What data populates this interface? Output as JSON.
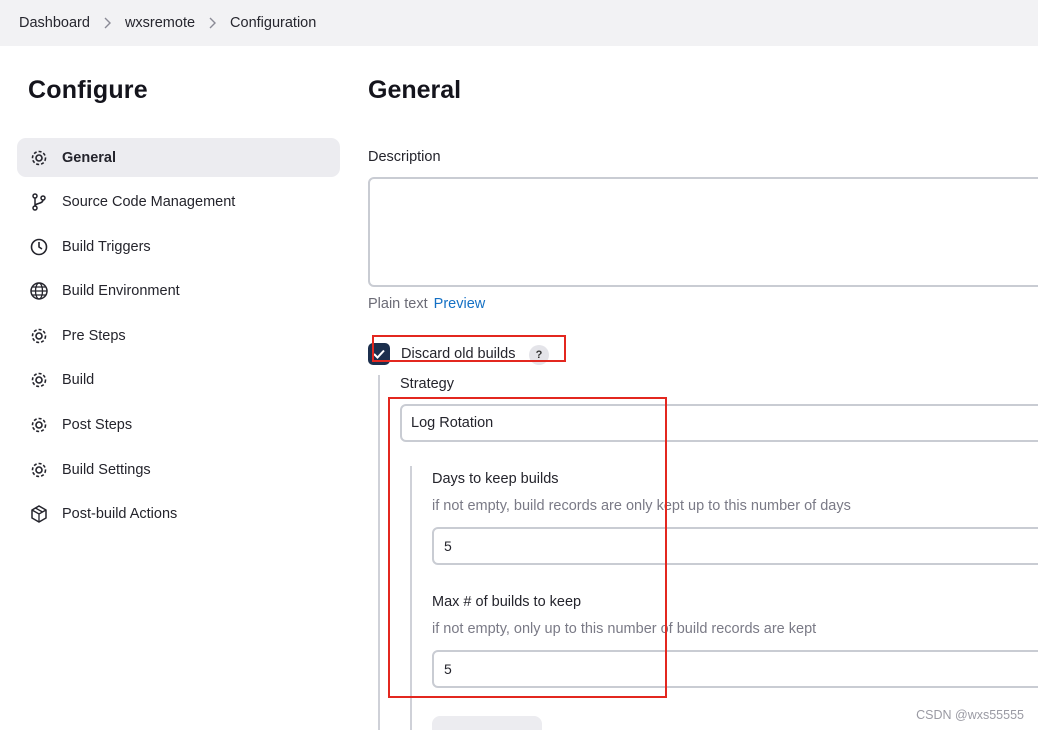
{
  "breadcrumb": {
    "items": [
      "Dashboard",
      "wxsremote",
      "Configuration"
    ]
  },
  "sidebar": {
    "title": "Configure",
    "items": [
      {
        "label": "General",
        "icon": "gear-icon",
        "active": true
      },
      {
        "label": "Source Code Management",
        "icon": "branch-icon"
      },
      {
        "label": "Build Triggers",
        "icon": "clock-icon"
      },
      {
        "label": "Build Environment",
        "icon": "globe-icon"
      },
      {
        "label": "Pre Steps",
        "icon": "gear-icon"
      },
      {
        "label": "Build",
        "icon": "gear-icon"
      },
      {
        "label": "Post Steps",
        "icon": "gear-icon"
      },
      {
        "label": "Build Settings",
        "icon": "gear-icon"
      },
      {
        "label": "Post-build Actions",
        "icon": "package-icon"
      }
    ]
  },
  "main": {
    "title": "General",
    "description_label": "Description",
    "description_value": "",
    "format_text": "Plain text",
    "preview_link": "Preview",
    "discard_old_builds": {
      "label": "Discard old builds",
      "checked": true,
      "help": "?"
    },
    "strategy": {
      "label": "Strategy",
      "selected": "Log Rotation"
    },
    "days_to_keep": {
      "label": "Days to keep builds",
      "hint": "if not empty, build records are only kept up to this number of days",
      "value": "5"
    },
    "max_builds": {
      "label": "Max # of builds to keep",
      "hint": "if not empty, only up to this number of build records are kept",
      "value": "5"
    }
  },
  "watermark": "CSDN @wxs55555",
  "colors": {
    "annotation": "#e3271f",
    "checkbox": "#1c2f4d",
    "link": "#1470c4"
  }
}
